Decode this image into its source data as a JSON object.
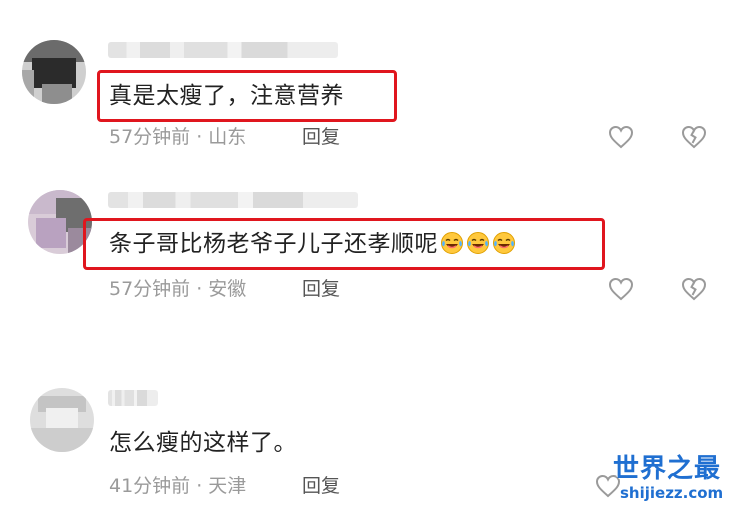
{
  "comments": [
    {
      "text": "真是太瘦了，注意营养",
      "time_location": "57分钟前 · 山东",
      "reply_label": "回复"
    },
    {
      "text": "条子哥比杨老爷子儿子还孝顺呢",
      "emoji_count": 3,
      "time_location": "57分钟前 · 安徽",
      "reply_label": "回复"
    },
    {
      "text": "怎么瘦的这样了。",
      "time_location": "41分钟前 · 天津",
      "reply_label": "回复"
    }
  ],
  "watermark": {
    "title": "世界之最",
    "url": "shijiezz.com"
  },
  "icons": {
    "like": "heart-outline-icon",
    "dislike": "broken-heart-icon",
    "emoji": "rofl-emoji-icon"
  },
  "colors": {
    "highlight": "#e0161e",
    "text": "#222222",
    "meta": "#9a9a9a",
    "watermark": "#1f6fd1"
  }
}
